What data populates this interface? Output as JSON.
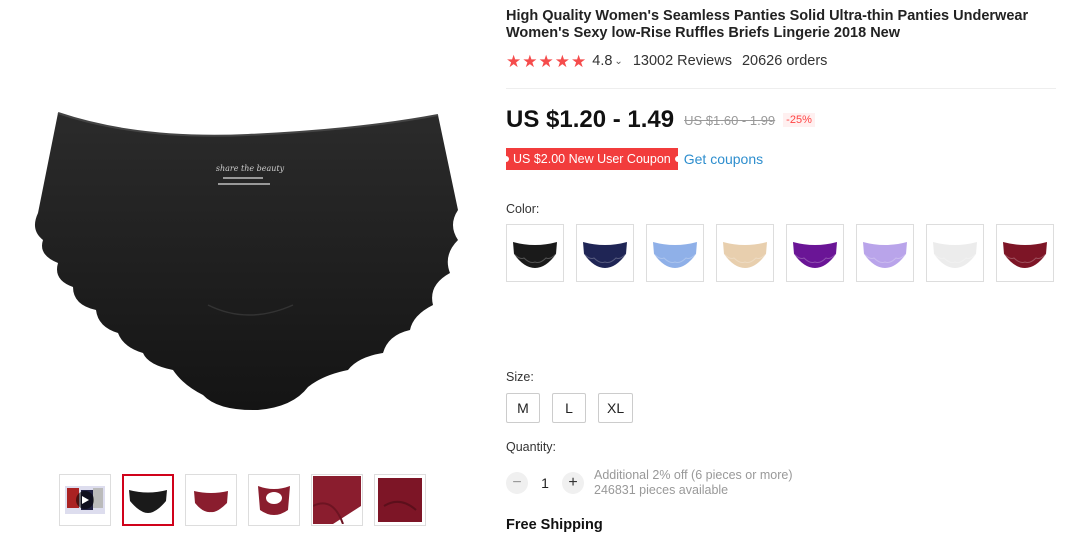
{
  "product": {
    "title": "High Quality Women's Seamless Panties Solid Ultra-thin Panties Underwear Women's Sexy low-Rise Ruffles Briefs Lingerie 2018 New",
    "rating": "4.8",
    "rating_fraction": 0.96,
    "reviews": "13002 Reviews",
    "orders": "20626 orders",
    "tag_brand": "share the beauty"
  },
  "price": {
    "current": "US $1.20 - 1.49",
    "original": "US $1.60 - 1.99",
    "discount": "-25%"
  },
  "coupon": {
    "badge": "US $2.00 New User Coupon",
    "link": "Get coupons"
  },
  "labels": {
    "color": "Color:",
    "size": "Size:",
    "quantity": "Quantity:"
  },
  "colors": [
    {
      "name": "black",
      "hex": "#1a1a1a"
    },
    {
      "name": "navy",
      "hex": "#1f2555"
    },
    {
      "name": "light-blue",
      "hex": "#8fb0e8"
    },
    {
      "name": "beige",
      "hex": "#e8cfae"
    },
    {
      "name": "purple",
      "hex": "#6a1596"
    },
    {
      "name": "lavender",
      "hex": "#b9a4ea"
    },
    {
      "name": "white",
      "hex": "#ececec"
    },
    {
      "name": "wine-red",
      "hex": "#7d1526"
    }
  ],
  "sizes": [
    "M",
    "L",
    "XL"
  ],
  "quantity": {
    "value": "1",
    "minus": "−",
    "plus": "+",
    "note1": "Additional 2% off (6 pieces or more)",
    "note2": "246831 pieces available"
  },
  "shipping": "Free Shipping",
  "thumbnails": [
    {
      "name": "video",
      "color": "#333",
      "has_play": true
    },
    {
      "name": "black",
      "color": "#1a1a1a",
      "active": true
    },
    {
      "name": "wine-flat",
      "color": "#8a1d2e"
    },
    {
      "name": "wine-cutout",
      "color": "#8a1d2e"
    },
    {
      "name": "wine-detail",
      "color": "#8a1d2e"
    },
    {
      "name": "wine-fabric",
      "color": "#7d1526"
    }
  ]
}
